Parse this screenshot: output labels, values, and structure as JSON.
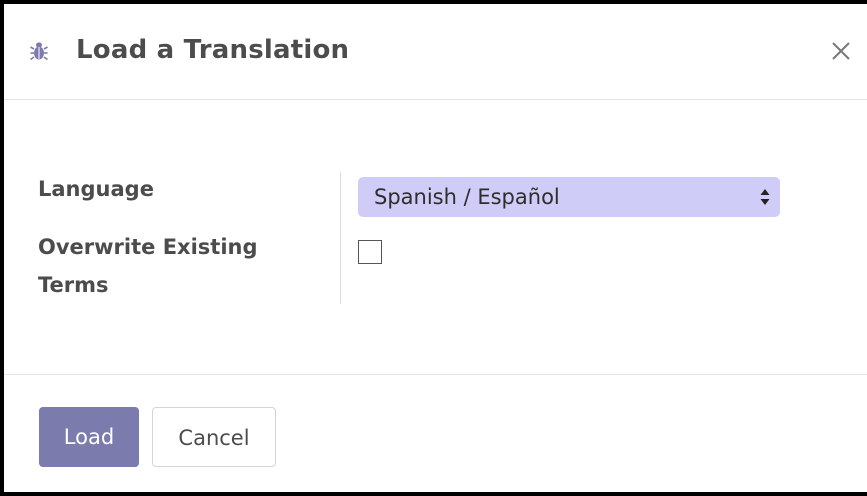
{
  "dialog": {
    "title": "Load a Translation",
    "debug_icon": "bug-icon",
    "close_icon": "close-icon"
  },
  "form": {
    "language_label": "Language",
    "language_value": "Spanish / Español",
    "overwrite_label": "Overwrite Existing Terms",
    "overwrite_checked": false
  },
  "footer": {
    "load_label": "Load",
    "cancel_label": "Cancel"
  },
  "colors": {
    "primary": "#7c7bad",
    "select_background": "#cfcdf7",
    "debug_icon": "#7c7bad"
  }
}
